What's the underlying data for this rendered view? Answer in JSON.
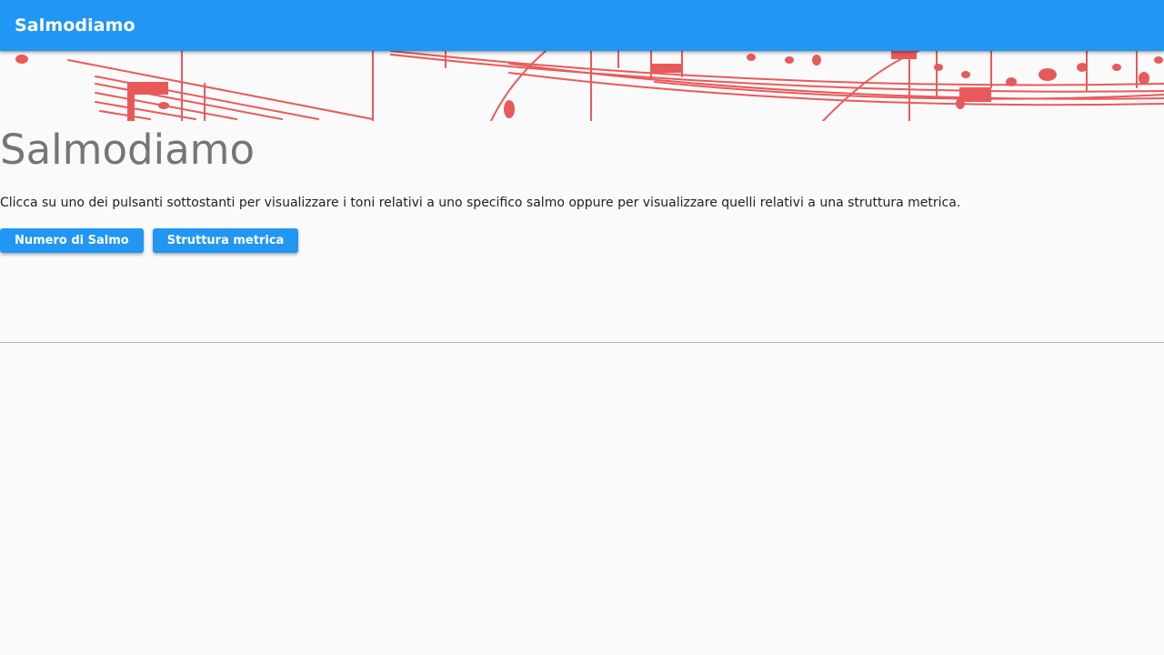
{
  "appbar": {
    "title": "Salmodiamo"
  },
  "banner": {
    "image": "music-score-banner",
    "ink_color": "#e85a5a"
  },
  "hero": {
    "title": "Salmodiamo",
    "description": "Clicca su uno dei pulsanti sottostanti per visualizzare i toni relativi a uno specifico salmo oppure per visualizzare quelli relativi a una struttura metrica."
  },
  "actions": {
    "psalm_number_label": "Numero di Salmo",
    "metric_structure_label": "Struttura metrica"
  },
  "colors": {
    "primary": "#2196f3",
    "background": "#fafafa",
    "title_text": "#757575",
    "body_text": "#212121"
  }
}
